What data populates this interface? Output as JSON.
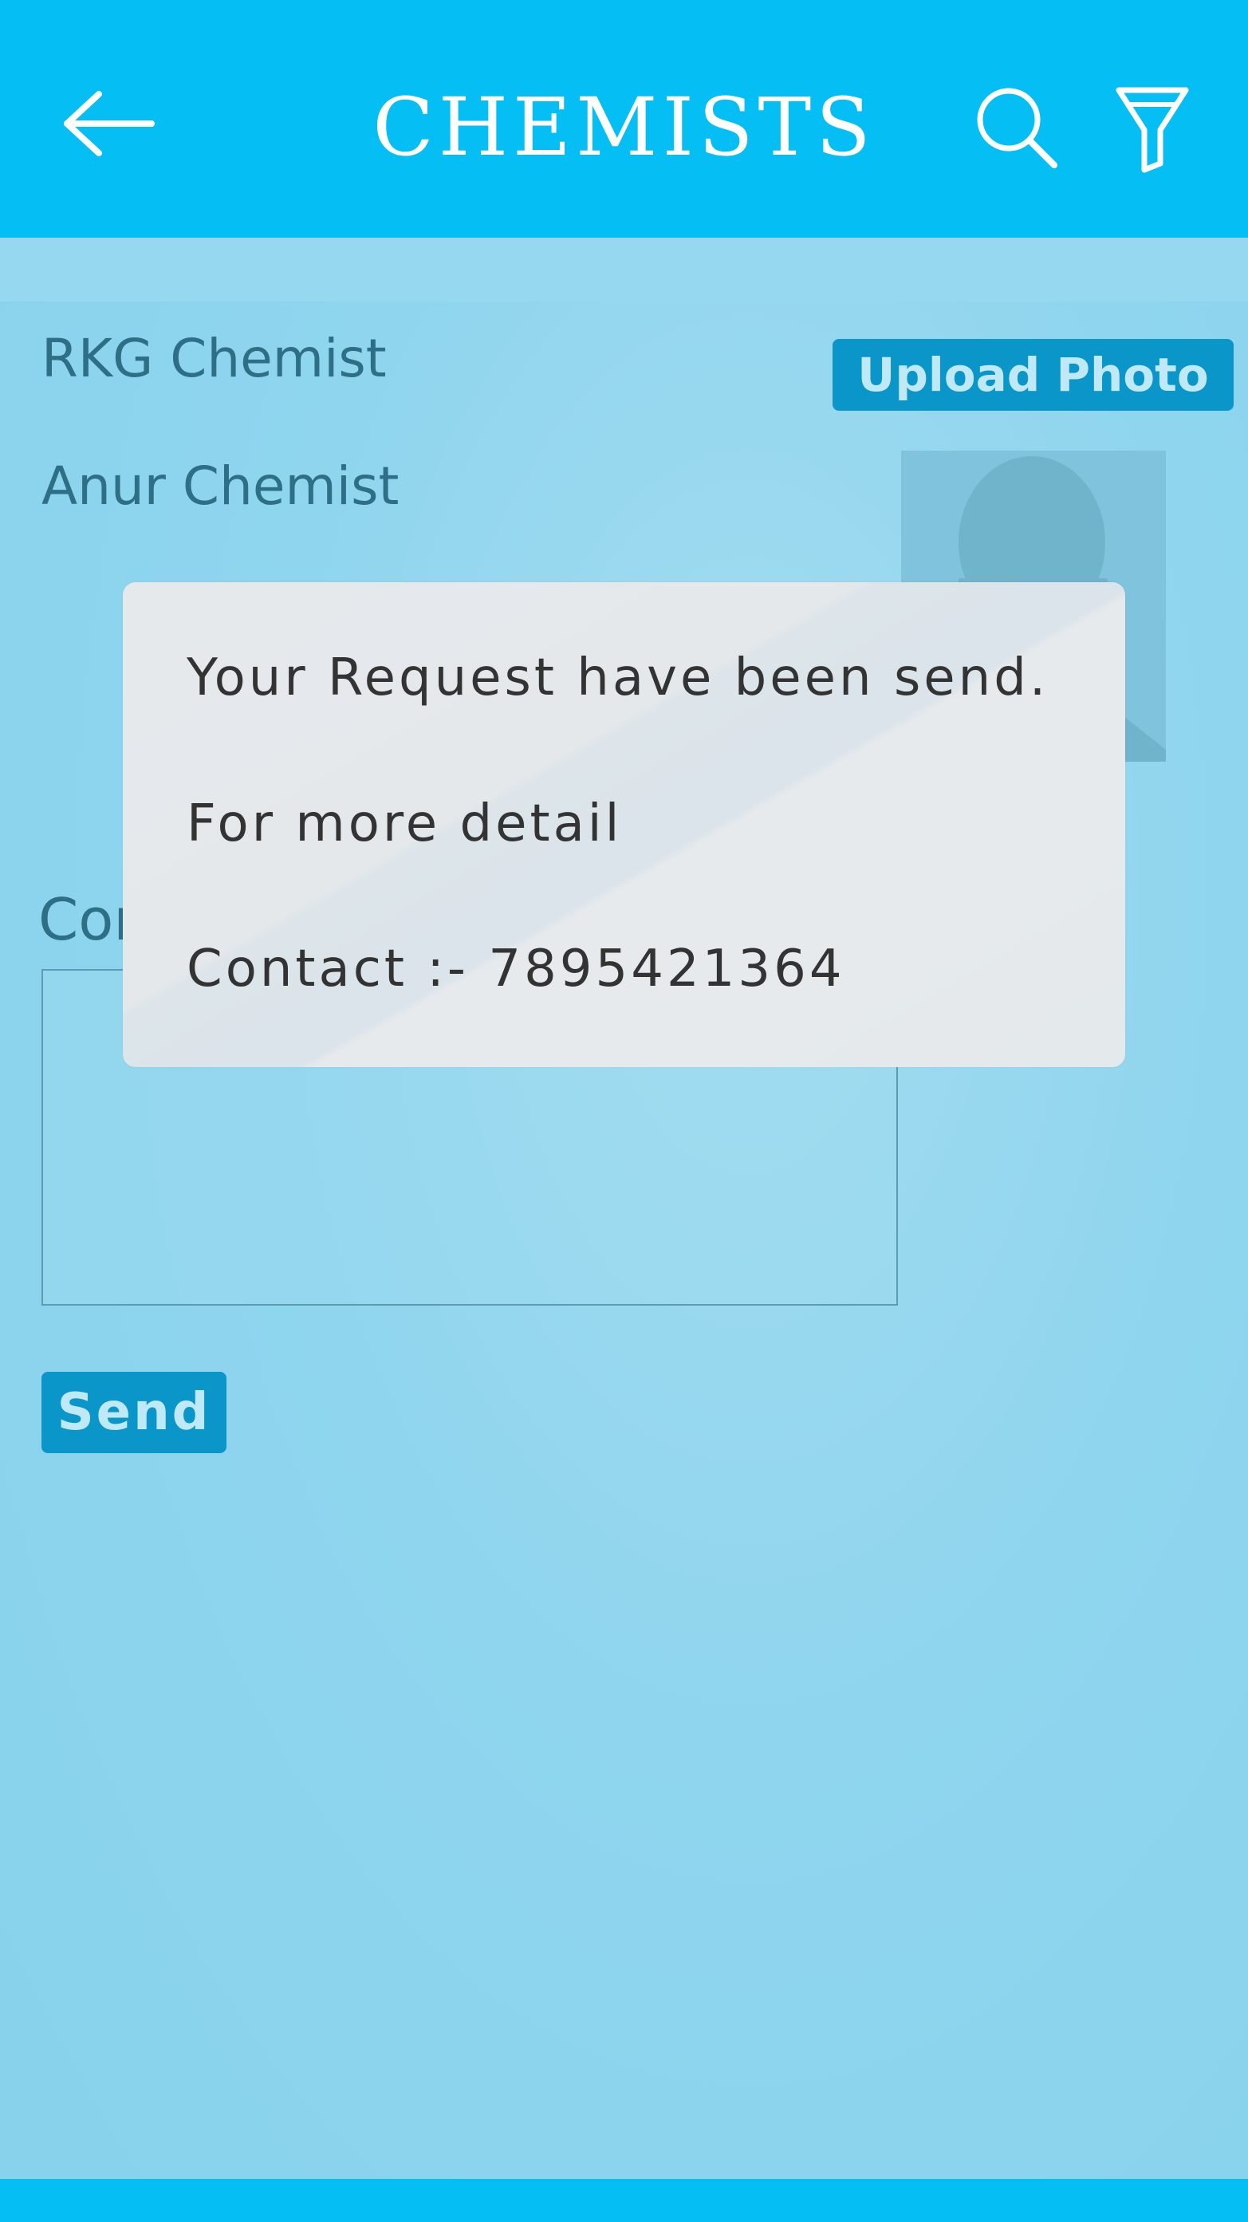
{
  "header": {
    "title": "CHEMISTS",
    "back_icon": "arrow-left-icon",
    "search_icon": "search-icon",
    "filter_icon": "filter-icon",
    "color": "#05bff4"
  },
  "details": {
    "chemist_name": "RKG Chemist",
    "contact_name": "Anur Chemist",
    "upload_label": "Upload Photo",
    "photo_icon": "user-placeholder-icon"
  },
  "comment": {
    "label": "Comment :-",
    "value": ""
  },
  "actions": {
    "send_label": "Send"
  },
  "dialog": {
    "line1": "Your Request have been send.",
    "line2": "For more detail",
    "line3": "Contact :- 7895421364"
  },
  "colors": {
    "accent": "#05bff4",
    "button": "#0a96c9",
    "background": "#8fd5ee"
  }
}
